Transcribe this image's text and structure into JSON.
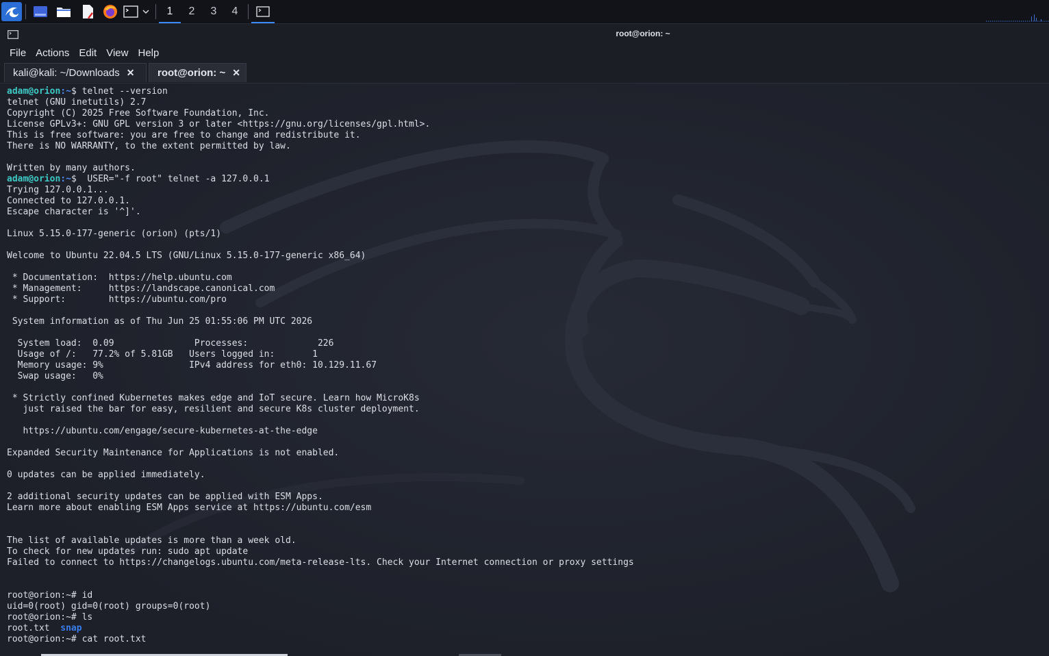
{
  "panel": {
    "workspaces": [
      "1",
      "2",
      "3",
      "4"
    ],
    "active_workspace": "1",
    "icons": [
      "kali-menu-icon",
      "desktop-icon",
      "file-manager-icon",
      "text-editor-icon",
      "firefox-icon",
      "terminal-icon",
      "chevron-down-icon",
      "terminal-window-icon"
    ]
  },
  "window": {
    "title": "root@orion: ~"
  },
  "menu": {
    "file": "File",
    "actions": "Actions",
    "edit": "Edit",
    "view": "View",
    "help": "Help"
  },
  "tabs": [
    {
      "label": "kali@kali: ~/Downloads",
      "close": "✕",
      "active": false
    },
    {
      "label": "root@orion: ~",
      "close": "✕",
      "active": true
    }
  ],
  "terminal": {
    "prompt_user": "adam@orion",
    "prompt_path": ":~",
    "prompt_sym": "$",
    "lines": [
      {
        "t": "prompt",
        "cmd": " telnet --version"
      },
      {
        "t": "text",
        "v": "telnet (GNU inetutils) 2.7"
      },
      {
        "t": "text",
        "v": "Copyright (C) 2025 Free Software Foundation, Inc."
      },
      {
        "t": "text",
        "v": "License GPLv3+: GNU GPL version 3 or later <https://gnu.org/licenses/gpl.html>."
      },
      {
        "t": "text",
        "v": "This is free software: you are free to change and redistribute it."
      },
      {
        "t": "text",
        "v": "There is NO WARRANTY, to the extent permitted by law."
      },
      {
        "t": "text",
        "v": ""
      },
      {
        "t": "text",
        "v": "Written by many authors."
      },
      {
        "t": "prompt",
        "cmd": "  USER=\"-f root\" telnet -a 127.0.0.1"
      },
      {
        "t": "text",
        "v": "Trying 127.0.0.1..."
      },
      {
        "t": "text",
        "v": "Connected to 127.0.0.1."
      },
      {
        "t": "text",
        "v": "Escape character is '^]'."
      },
      {
        "t": "text",
        "v": ""
      },
      {
        "t": "text",
        "v": "Linux 5.15.0-177-generic (orion) (pts/1)"
      },
      {
        "t": "text",
        "v": ""
      },
      {
        "t": "text",
        "v": "Welcome to Ubuntu 22.04.5 LTS (GNU/Linux 5.15.0-177-generic x86_64)"
      },
      {
        "t": "text",
        "v": ""
      },
      {
        "t": "text",
        "v": " * Documentation:  https://help.ubuntu.com"
      },
      {
        "t": "text",
        "v": " * Management:     https://landscape.canonical.com"
      },
      {
        "t": "text",
        "v": " * Support:        https://ubuntu.com/pro"
      },
      {
        "t": "text",
        "v": ""
      },
      {
        "t": "text",
        "v": " System information as of Thu Jun 25 01:55:06 PM UTC 2026"
      },
      {
        "t": "text",
        "v": ""
      },
      {
        "t": "text",
        "v": "  System load:  0.09               Processes:             226"
      },
      {
        "t": "text",
        "v": "  Usage of /:   77.2% of 5.81GB   Users logged in:       1"
      },
      {
        "t": "text",
        "v": "  Memory usage: 9%                IPv4 address for eth0: 10.129.11.67"
      },
      {
        "t": "text",
        "v": "  Swap usage:   0%"
      },
      {
        "t": "text",
        "v": ""
      },
      {
        "t": "text",
        "v": " * Strictly confined Kubernetes makes edge and IoT secure. Learn how MicroK8s"
      },
      {
        "t": "text",
        "v": "   just raised the bar for easy, resilient and secure K8s cluster deployment."
      },
      {
        "t": "text",
        "v": ""
      },
      {
        "t": "text",
        "v": "   https://ubuntu.com/engage/secure-kubernetes-at-the-edge"
      },
      {
        "t": "text",
        "v": ""
      },
      {
        "t": "text",
        "v": "Expanded Security Maintenance for Applications is not enabled."
      },
      {
        "t": "text",
        "v": ""
      },
      {
        "t": "text",
        "v": "0 updates can be applied immediately."
      },
      {
        "t": "text",
        "v": ""
      },
      {
        "t": "text",
        "v": "2 additional security updates can be applied with ESM Apps."
      },
      {
        "t": "text",
        "v": "Learn more about enabling ESM Apps service at https://ubuntu.com/esm"
      },
      {
        "t": "text",
        "v": ""
      },
      {
        "t": "text",
        "v": ""
      },
      {
        "t": "text",
        "v": "The list of available updates is more than a week old."
      },
      {
        "t": "text",
        "v": "To check for new updates run: sudo apt update"
      },
      {
        "t": "text",
        "v": "Failed to connect to https://changelogs.ubuntu.com/meta-release-lts. Check your Internet connection or proxy settings"
      },
      {
        "t": "text",
        "v": ""
      },
      {
        "t": "text",
        "v": ""
      },
      {
        "t": "text",
        "v": "root@orion:~# id"
      },
      {
        "t": "text",
        "v": "uid=0(root) gid=0(root) groups=0(root)"
      },
      {
        "t": "text",
        "v": "root@orion:~# ls"
      },
      {
        "t": "ls",
        "file": "root.txt",
        "gap": "  ",
        "dir": "snap"
      },
      {
        "t": "text",
        "v": "root@orion:~# cat root.txt"
      }
    ]
  },
  "colors": {
    "prompt_user": "#3ec9c4",
    "prompt_path": "#4e8cf0",
    "directory": "#3a7ef0",
    "accent": "#3b8cff"
  }
}
